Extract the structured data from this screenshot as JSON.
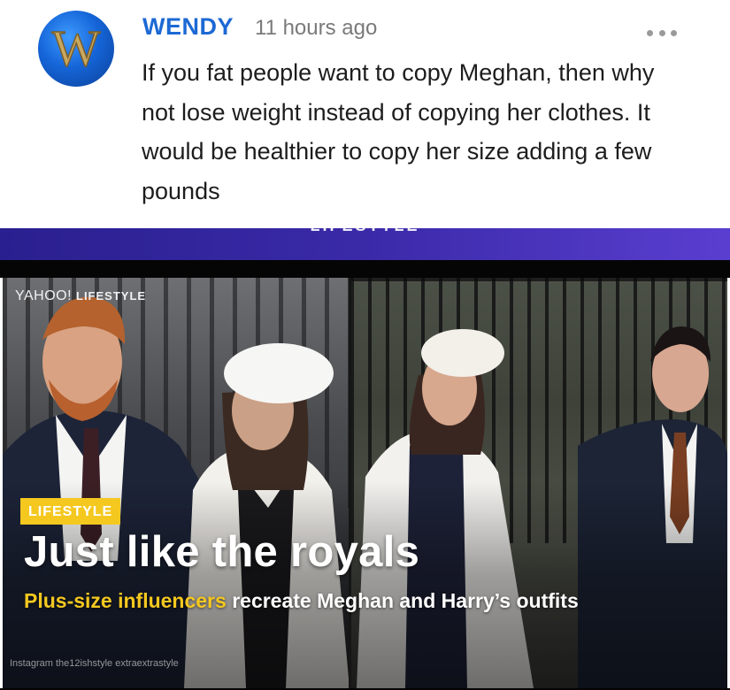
{
  "comment": {
    "author": "WENDY",
    "time": "11 hours ago",
    "text": "If you fat people want to copy Meghan, then why not lose weight instead of copying her clothes. It would be healthier to copy her size adding a few pounds",
    "avatar_letter": "W",
    "more_icon": "more-horizontal-icon"
  },
  "header_strip": {
    "label": "LIFESTYLE"
  },
  "video": {
    "brand_main": "YAHOO!",
    "brand_section": "LIFESTYLE",
    "tag": "LIFESTYLE",
    "headline": "Just like the royals",
    "subline_highlight": "Plus-size influencers",
    "subline_rest": " recreate Meghan and Harry’s outfits",
    "credit": "Instagram the12ishstyle extraextrastyle"
  },
  "colors": {
    "author_blue": "#1c69d4",
    "tag_yellow": "#f5c820",
    "strip_purple": "#3a2aa8"
  }
}
